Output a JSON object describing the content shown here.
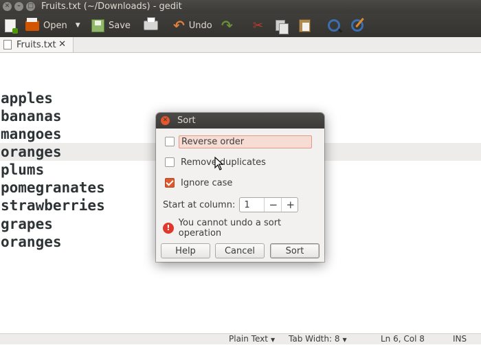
{
  "window": {
    "title": "Fruits.txt (~/Downloads) - gedit"
  },
  "toolbar": {
    "open_label": "Open",
    "save_label": "Save",
    "undo_label": "Undo"
  },
  "tab": {
    "label": "Fruits.txt"
  },
  "editor": {
    "lines": [
      "apples",
      "bananas",
      "mangoes",
      "oranges",
      "plums",
      "pomegranates",
      "strawberries",
      "grapes",
      "oranges"
    ],
    "current_line": 6,
    "current_column": 8
  },
  "statusbar": {
    "language": "Plain Text",
    "tab_width": "Tab Width: 8",
    "position": "Ln 6, Col 8",
    "mode": "INS"
  },
  "dialog": {
    "title": "Sort",
    "options": [
      {
        "label": "Reverse order",
        "checked": false
      },
      {
        "label": "Remove duplicates",
        "checked": false
      },
      {
        "label": "Ignore case",
        "checked": true
      }
    ],
    "start_column_label": "Start at column:",
    "start_column_value": "1",
    "warning": "You cannot undo a sort operation",
    "buttons": {
      "help": "Help",
      "cancel": "Cancel",
      "sort": "Sort"
    }
  },
  "colors": {
    "accent": "#dd5a2f",
    "titlebar": "#3c3b37",
    "current_line": "#edeceb"
  }
}
